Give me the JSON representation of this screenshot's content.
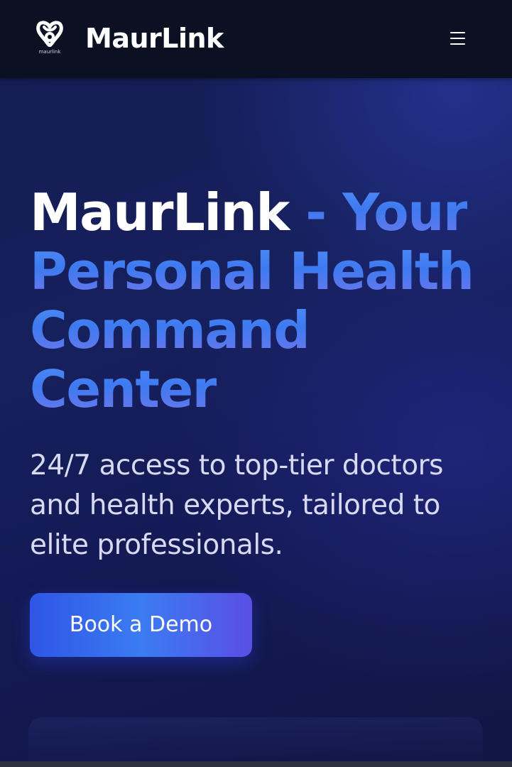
{
  "header": {
    "logo_small_text": "maurlink",
    "brand": "MaurLink",
    "menu_icon": "hamburger-menu-icon"
  },
  "hero": {
    "title_part1": "MaurLink",
    "title_part2": " - Your Personal Health Command Center",
    "subtitle": "24/7 access to top-tier doctors and health experts, tailored to elite professionals.",
    "cta_label": "Book a Demo"
  },
  "colors": {
    "header_bg": "#0b1023",
    "hero_bg": "#151d55",
    "accent_blue": "#4f8cf5",
    "accent_purple": "#6b7ef0",
    "text_white": "#ffffff"
  }
}
